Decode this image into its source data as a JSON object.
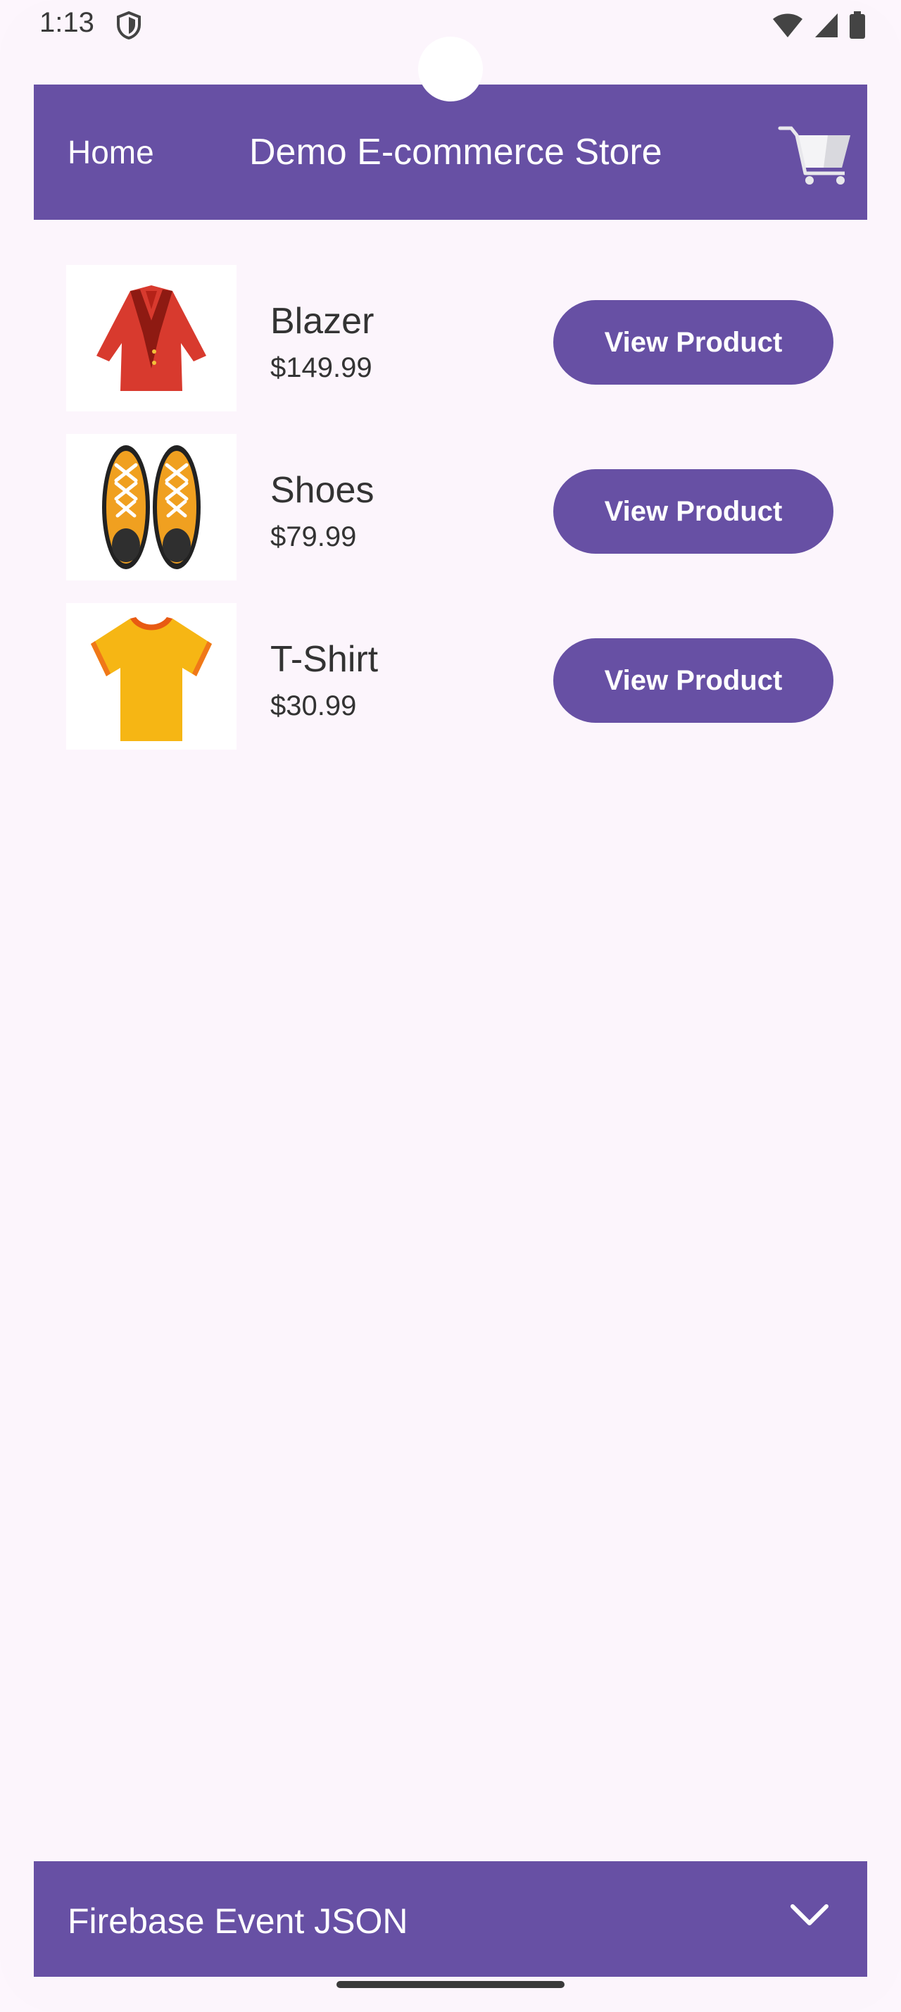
{
  "status_bar": {
    "time": "1:13"
  },
  "app_bar": {
    "home_label": "Home",
    "title": "Demo E-commerce Store",
    "cart_icon": "shopping-cart-icon"
  },
  "products": [
    {
      "name": "Blazer",
      "price": "$149.99",
      "button_label": "View Product",
      "image": "red-blazer"
    },
    {
      "name": "Shoes",
      "price": "$79.99",
      "button_label": "View Product",
      "image": "yellow-sneakers"
    },
    {
      "name": "T-Shirt",
      "price": "$30.99",
      "button_label": "View Product",
      "image": "yellow-tshirt"
    }
  ],
  "bottom_panel": {
    "title": "Firebase Event JSON",
    "expand_icon": "chevron-down-icon"
  },
  "colors": {
    "primary": "#6750a4",
    "background": "#fcf5fc",
    "text": "#333333"
  }
}
